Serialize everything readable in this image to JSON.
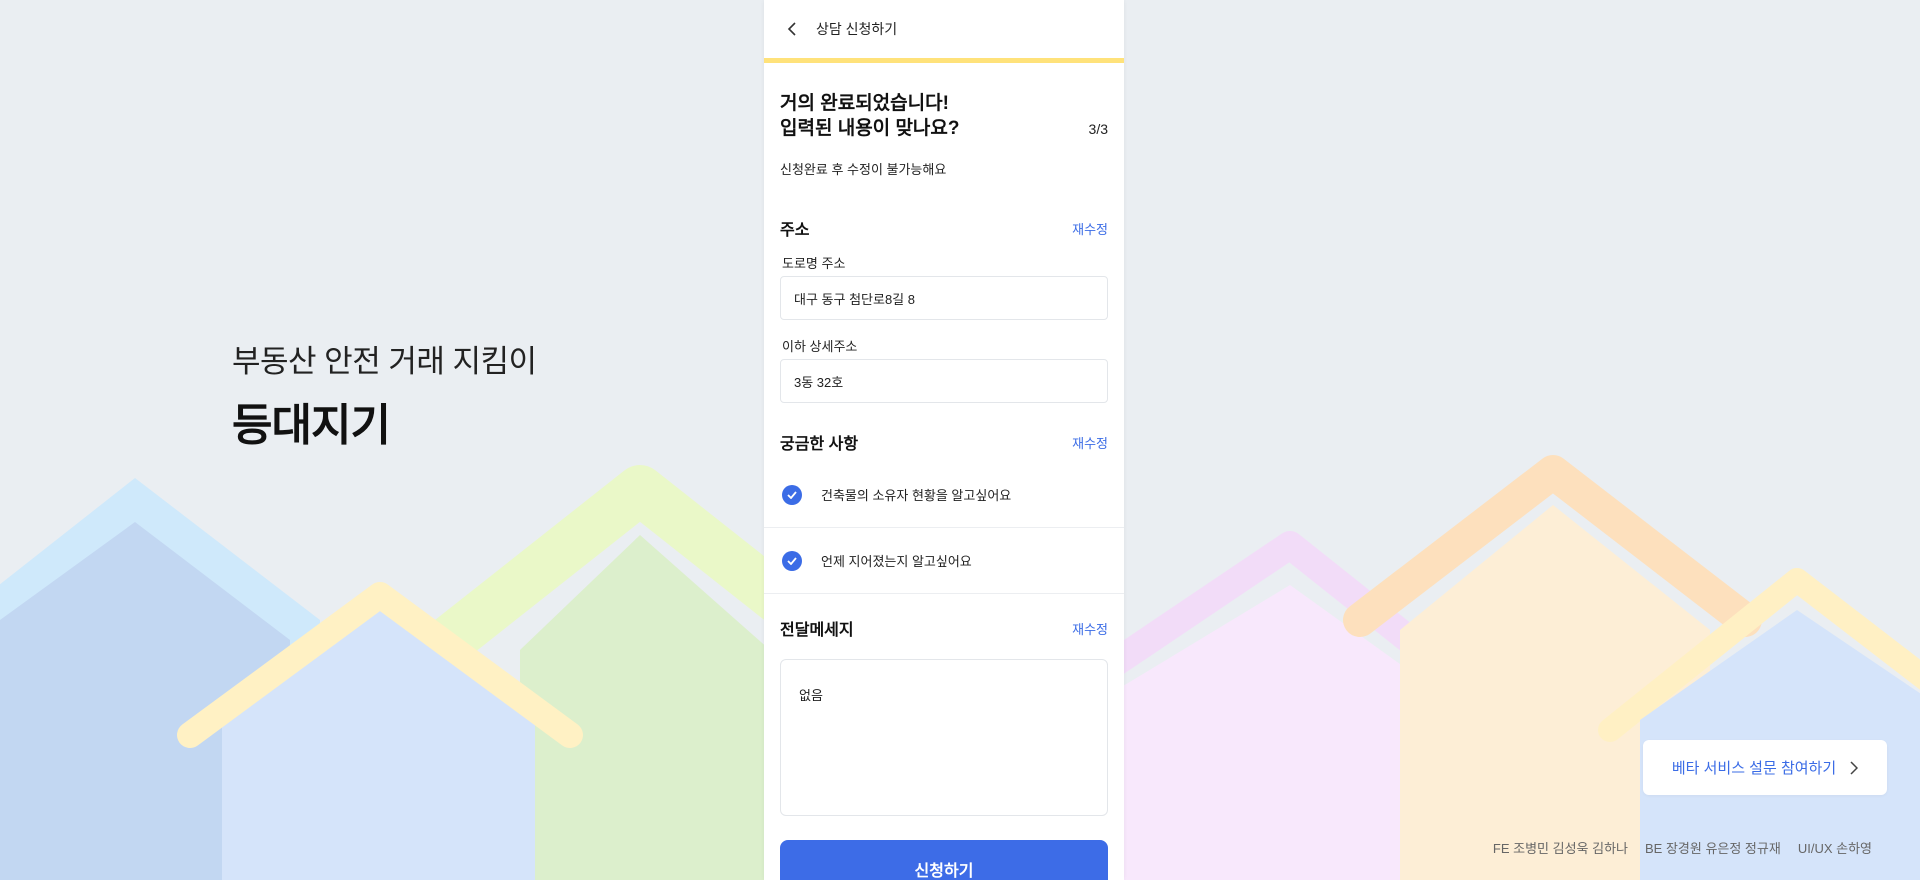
{
  "brand": {
    "tagline": "부동산 안전 거래 지킴이",
    "name": "등대지기"
  },
  "header": {
    "back_icon": "chevron-left-icon",
    "title": "상담 신청하기",
    "progress_color": "#ffe27a"
  },
  "form": {
    "step": "3/3",
    "headline_line1": "거의 완료되었습니다!",
    "headline_line2": "입력된 내용이 맞나요?",
    "notice": "신청완료 후 수정이 불가능해요",
    "address": {
      "title": "주소",
      "edit_label": "재수정",
      "road_label": "도로명 주소",
      "road_value": "대구 동구 첨단로8길 8",
      "detail_label": "이하 상세주소",
      "detail_value": "3동 32호"
    },
    "questions": {
      "title": "궁금한 사항",
      "edit_label": "재수정",
      "items": [
        {
          "text": "건축물의 소유자 현황을 알고싶어요"
        },
        {
          "text": "언제 지어졌는지 알고싶어요"
        }
      ]
    },
    "message": {
      "title": "전달메세지",
      "edit_label": "재수정",
      "value": "없음"
    },
    "submit_label": "신청하기",
    "accent_color": "#3d6ce7"
  },
  "survey": {
    "label": "베타 서비스 설문 참여하기",
    "icon": "chevron-right-icon"
  },
  "credits": [
    "FE 조병민 김성욱 김하나",
    "BE 장경원 유은정 정규재",
    "UI/UX 손하영"
  ]
}
